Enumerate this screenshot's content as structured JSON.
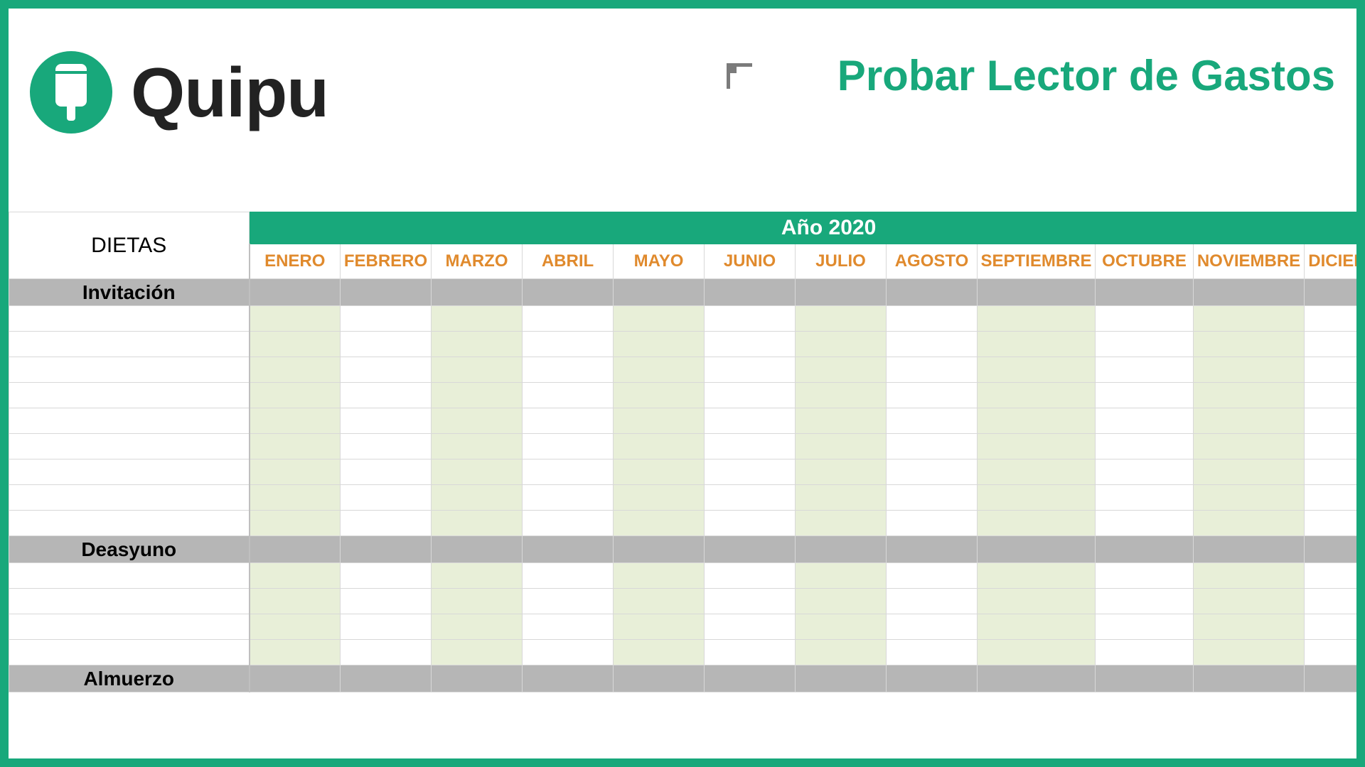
{
  "brand": {
    "name": "Quipu"
  },
  "header": {
    "cta": "Probar Lector de Gastos"
  },
  "sheet": {
    "corner_title": "DIETAS",
    "year_label": "Año 2020",
    "months": [
      "ENERO",
      "FEBRERO",
      "MARZO",
      "ABRIL",
      "MAYO",
      "JUNIO",
      "JULIO",
      "AGOSTO",
      "SEPTIEMBRE",
      "OCTUBRE",
      "NOVIEMBRE",
      "DICIEMBRE"
    ],
    "shaded_month_indices": [
      0,
      2,
      4,
      6,
      8,
      10
    ],
    "sections": [
      {
        "title": "Invitación",
        "blank_rows": 9
      },
      {
        "title": "Deasyuno",
        "blank_rows": 4
      },
      {
        "title": "Almuerzo",
        "blank_rows": 0
      }
    ]
  },
  "colors": {
    "brand_green": "#18a87b",
    "orange": "#e08a2d",
    "section_gray": "#b6b6b6",
    "soft_green": "#e8efd8"
  }
}
